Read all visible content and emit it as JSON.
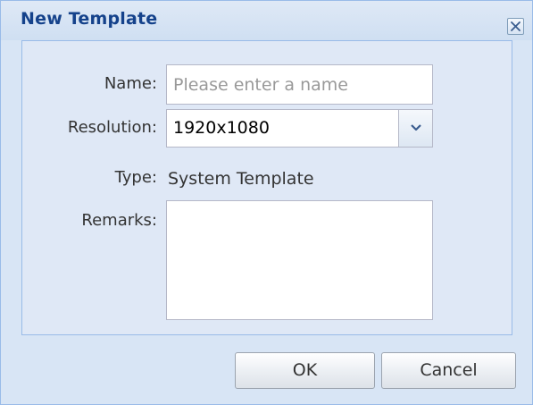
{
  "dialog": {
    "title": "New Template"
  },
  "form": {
    "name_label": "Name:",
    "name_placeholder": "Please enter a name",
    "name_value": "",
    "resolution_label": "Resolution:",
    "resolution_value": "1920x1080",
    "type_label": "Type:",
    "type_value": "System Template",
    "remarks_label": "Remarks:",
    "remarks_value": ""
  },
  "buttons": {
    "ok_label": "OK",
    "cancel_label": "Cancel"
  },
  "icons": {
    "close": "close-icon",
    "dropdown": "chevron-down-icon"
  },
  "colors": {
    "title": "#15428b",
    "border": "#99bbe8",
    "panel_background": "#dfe8f6"
  }
}
